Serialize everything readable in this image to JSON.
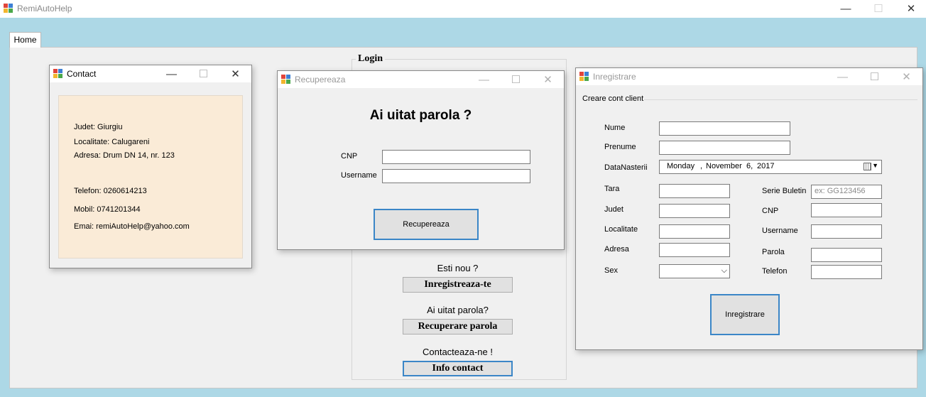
{
  "main_window": {
    "title": "RemiAutoHelp",
    "tab": "Home"
  },
  "login": {
    "legend": "Login",
    "new_question": "Esti nou ?",
    "register_button": "Inregistreaza-te",
    "forgot_question": "Ai uitat parola?",
    "recover_button": "Recuperare parola",
    "contact_question": "Contacteaza-ne !",
    "contact_button": "Info contact"
  },
  "contact_window": {
    "title": "Contact",
    "judet": "Judet: Giurgiu",
    "localitate": "Localitate: Calugareni",
    "adresa": "Adresa: Drum DN 14, nr. 123",
    "telefon": "Telefon: 0260614213",
    "mobil": "Mobil: 0741201344",
    "email": "Emai: remiAutoHelp@yahoo.com"
  },
  "recover_window": {
    "title": "Recupereaza",
    "heading": "Ai uitat parola ?",
    "cnp_label": "CNP",
    "cnp_value": "",
    "username_label": "Username",
    "username_value": "",
    "submit_button": "Recupereaza"
  },
  "register_window": {
    "title": "Inregistrare",
    "group_label": "Creare cont client",
    "nume_label": "Nume",
    "prenume_label": "Prenume",
    "data_label": "DataNasterii",
    "data_day": "Monday",
    "data_month": "November",
    "data_daynum": "6,",
    "data_year": "2017",
    "tara_label": "Tara",
    "judet_label": "Judet",
    "localitate_label": "Localitate",
    "adresa_label": "Adresa",
    "sex_label": "Sex",
    "sex_value": "",
    "serie_label": "Serie Buletin",
    "serie_placeholder": "ex: GG123456",
    "cnp_label": "CNP",
    "username_label": "Username",
    "parola_label": "Parola",
    "telefon_label": "Telefon",
    "submit_button": "Inregistrare"
  }
}
